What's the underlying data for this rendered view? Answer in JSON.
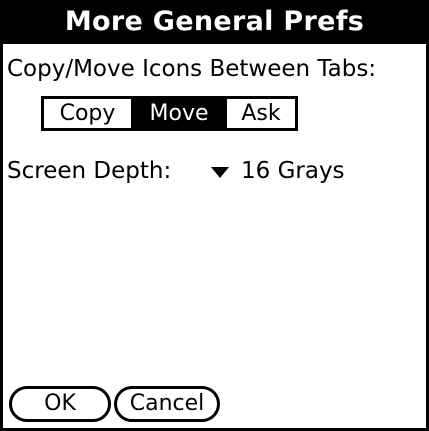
{
  "dialog": {
    "title": "More General Prefs"
  },
  "copy_move": {
    "label": "Copy/Move Icons Between Tabs:",
    "options": [
      "Copy",
      "Move",
      "Ask"
    ],
    "selected": "Move"
  },
  "screen_depth": {
    "label": "Screen Depth:",
    "value": "16 Grays",
    "icon": "triangle-down-icon"
  },
  "buttons": {
    "ok_label": "OK",
    "cancel_label": "Cancel"
  },
  "colors": {
    "foreground": "#000000",
    "background": "#ffffff"
  }
}
